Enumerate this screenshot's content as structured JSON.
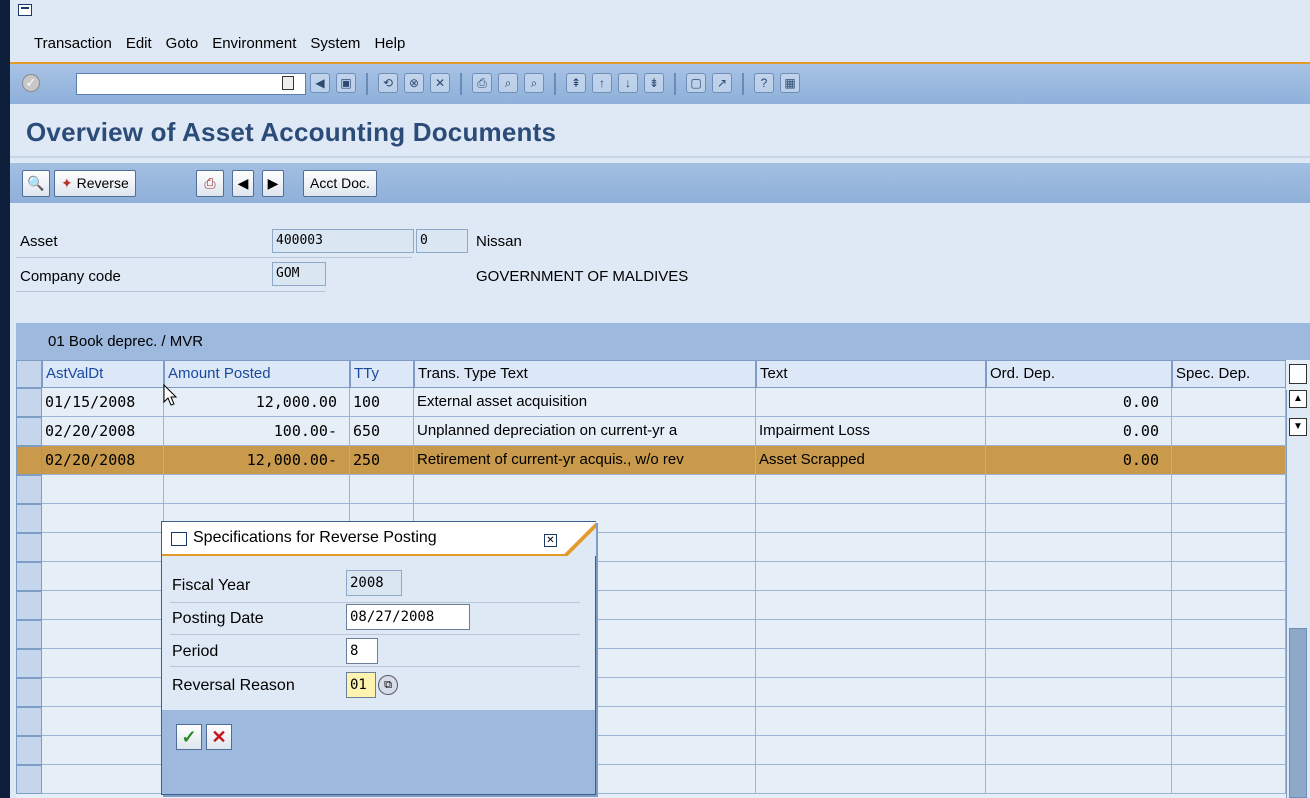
{
  "menu": {
    "items": [
      "Transaction",
      "Edit",
      "Goto",
      "Environment",
      "System",
      "Help"
    ]
  },
  "toolbar": {
    "command_field_value": "",
    "icons": [
      "enter-icon",
      "back-icon",
      "save-icon",
      "back-nav-icon",
      "exit-icon",
      "cancel-icon",
      "print-icon",
      "find-icon",
      "find-next-icon",
      "first-page-icon",
      "prev-page-icon",
      "next-page-icon",
      "last-page-icon",
      "new-session-icon",
      "shortcut-icon",
      "help-icon",
      "layout-icon"
    ]
  },
  "page": {
    "title": "Overview of Asset Accounting Documents"
  },
  "app_toolbar": {
    "reverse_label": "Reverse",
    "acct_doc_label": "Acct Doc."
  },
  "header": {
    "asset_label": "Asset",
    "asset_value": "400003",
    "sub_number": "0",
    "asset_desc": "Nissan",
    "company_code_label": "Company code",
    "company_code_value": "GOM",
    "company_name": "GOVERNMENT OF MALDIVES"
  },
  "table": {
    "title": "01 Book deprec. / MVR",
    "columns": [
      "AstValDt",
      "Amount Posted",
      "TTy",
      "Trans. Type Text",
      "Text",
      "Ord. Dep.",
      "Spec. Dep."
    ],
    "rows": [
      {
        "date": "01/15/2008",
        "amount": "12,000.00",
        "tty": "100",
        "ttext": "External asset acquisition",
        "text": "",
        "ord": "0.00",
        "spec": ""
      },
      {
        "date": "02/20/2008",
        "amount": "100.00-",
        "tty": "650",
        "ttext": "Unplanned depreciation on current-yr a",
        "text": "Impairment Loss",
        "ord": "0.00",
        "spec": ""
      },
      {
        "date": "02/20/2008",
        "amount": "12,000.00-",
        "tty": "250",
        "ttext": "Retirement of current-yr acquis., w/o rev",
        "text": "Asset Scrapped",
        "ord": "0.00",
        "spec": ""
      }
    ]
  },
  "dialog": {
    "title": "Specifications for Reverse Posting",
    "fiscal_year_label": "Fiscal Year",
    "fiscal_year_value": "2008",
    "posting_date_label": "Posting Date",
    "posting_date_value": "08/27/2008",
    "period_label": "Period",
    "period_value": "8",
    "reversal_reason_label": "Reversal Reason",
    "reversal_reason_value": "01"
  }
}
